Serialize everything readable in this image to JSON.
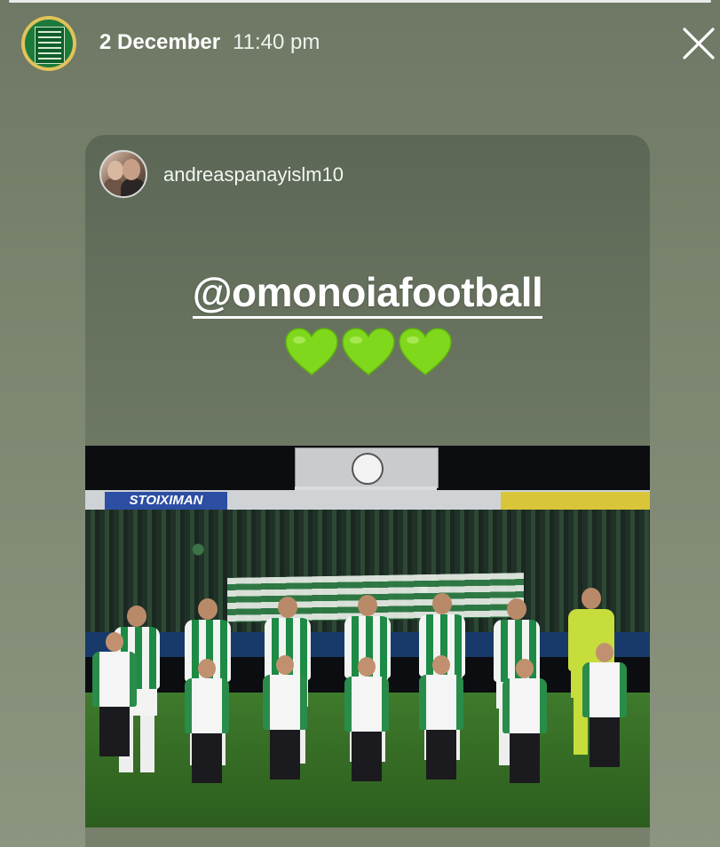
{
  "story": {
    "date": "2 December",
    "time": "11:40 pm",
    "avatar_icon": "team-lineup-board-icon",
    "close_icon": "close-icon"
  },
  "repost": {
    "username": "andreaspanayislm10",
    "mention": "@omonoiafootball",
    "hearts": [
      "💚",
      "💚",
      "💚"
    ],
    "heart_color": "#7fd81c"
  },
  "photo": {
    "stadium_sign_left": "STOIXIMAN",
    "description_icon": "team-photo-image"
  }
}
